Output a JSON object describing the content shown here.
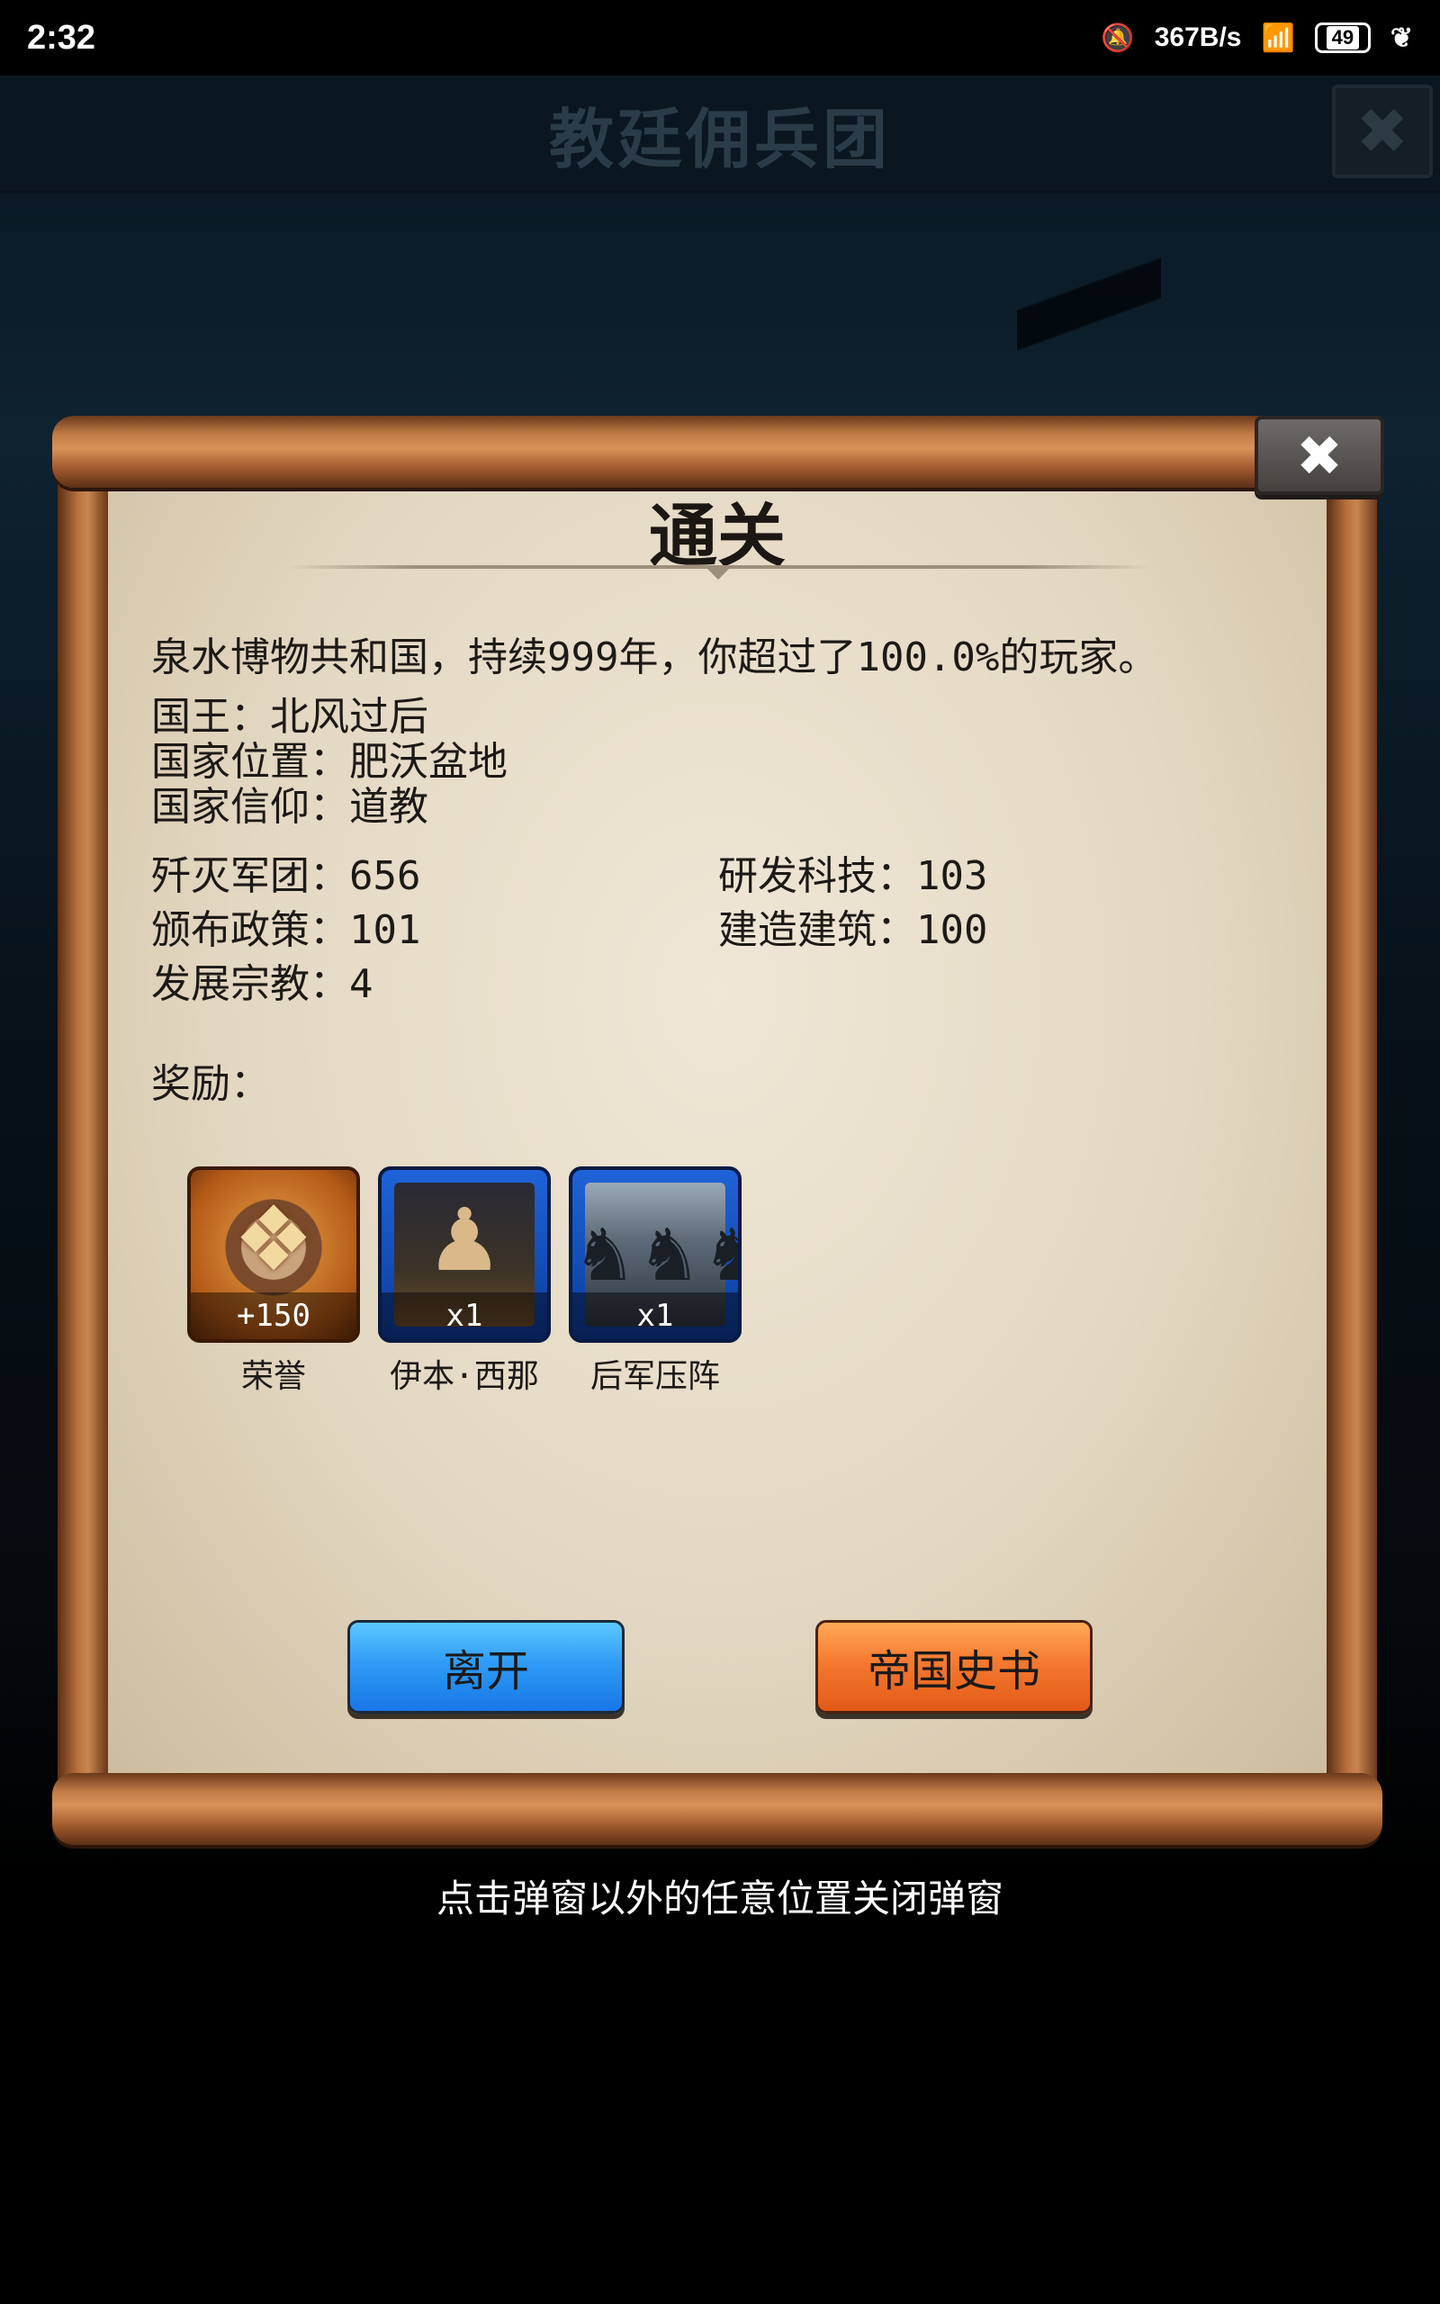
{
  "status_bar": {
    "time": "2:32",
    "network_speed": "367B/s",
    "battery": "49",
    "icons": [
      "bell-muted-icon",
      "wifi-icon",
      "battery-icon",
      "leaf-icon"
    ]
  },
  "game": {
    "title": "教廷佣兵团",
    "close_glyph": "✖"
  },
  "dialog": {
    "close_glyph": "✖",
    "title": "通关",
    "summary": "泉水博物共和国，持续999年，你超过了100.0%的玩家。",
    "info": [
      "国王：北风过后",
      "国家位置：肥沃盆地",
      "国家信仰：道教"
    ],
    "stats": [
      "歼灭军团：656",
      "研发科技：103",
      "颁布政策：101",
      "建造建筑：100",
      "发展宗教：4"
    ],
    "rewards_label": "奖励：",
    "rewards": [
      {
        "name": "荣誉",
        "qty": "+150",
        "icon": "honor-medal-icon",
        "rarity_color": "#c8661f"
      },
      {
        "name": "伊本·西那",
        "qty": "x1",
        "icon": "hero-portrait-icon",
        "rarity_color": "#1e63d8"
      },
      {
        "name": "后军压阵",
        "qty": "x1",
        "icon": "army-card-icon",
        "rarity_color": "#1e63d8"
      }
    ],
    "buttons": {
      "leave": "离开",
      "history": "帝国史书"
    }
  },
  "hint": "点击弹窗以外的任意位置关闭弹窗"
}
